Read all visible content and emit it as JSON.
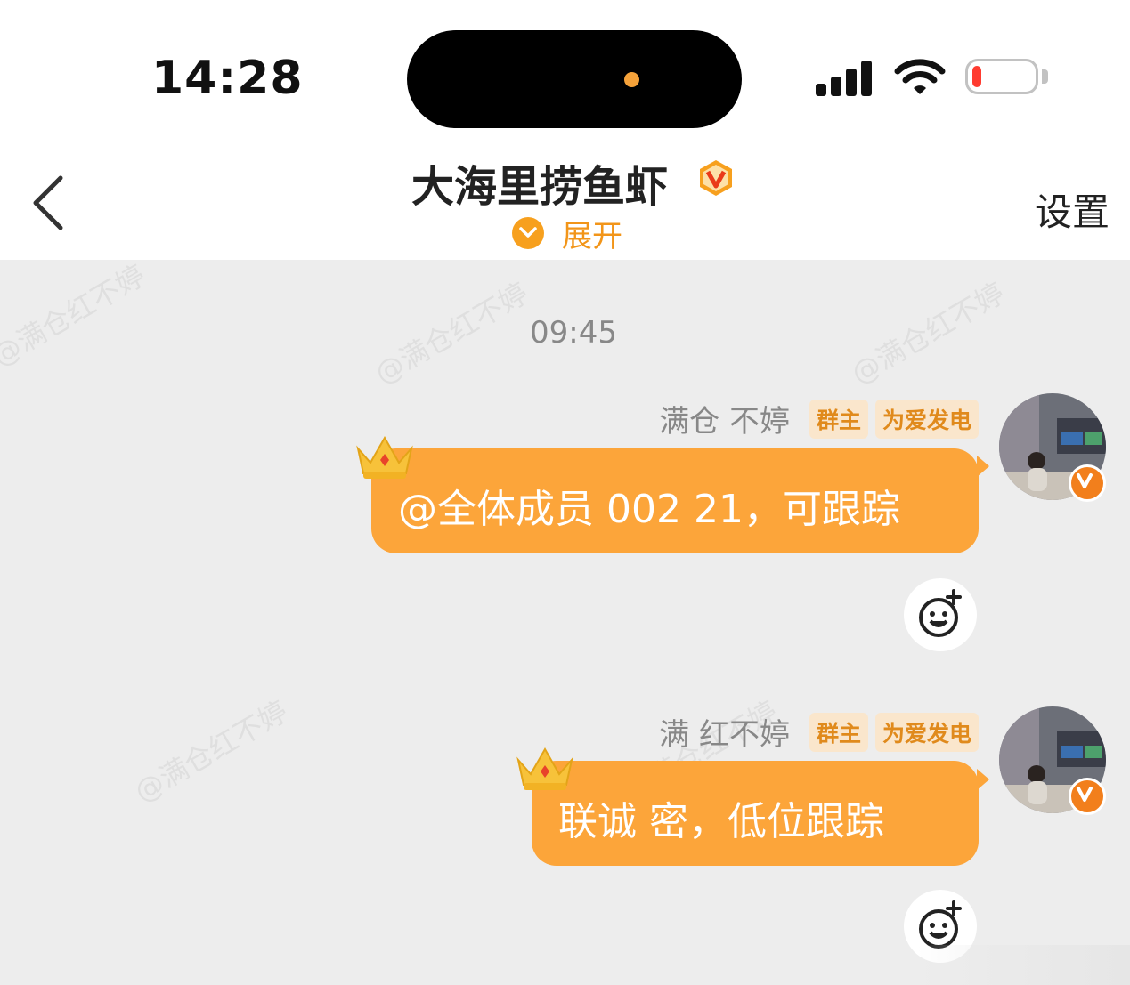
{
  "status_bar": {
    "time": "14:28"
  },
  "header": {
    "back_icon": "chevron-left-icon",
    "title": "大海里捞鱼虾",
    "verified_icon": "v-badge-icon",
    "expand_label": "展开",
    "settings_label": "设置"
  },
  "watermark": "@满仓红不婷",
  "chat": {
    "timestamp": "09:45",
    "messages": [
      {
        "sender": "满仓 不婷",
        "tags": [
          "群主",
          "为爱发电"
        ],
        "text": "@全体成员 002 21，可跟踪",
        "react_icon": "add-emoji-icon"
      },
      {
        "sender": "满 红不婷",
        "tags": [
          "群主",
          "为爱发电"
        ],
        "text": "联诚 密，低位跟踪",
        "react_icon": "add-emoji-icon"
      }
    ]
  },
  "colors": {
    "accent": "#fca53a",
    "tag_bg": "#fae6cc",
    "tag_text": "#e08a1c",
    "battery_low": "#ff3b30"
  }
}
